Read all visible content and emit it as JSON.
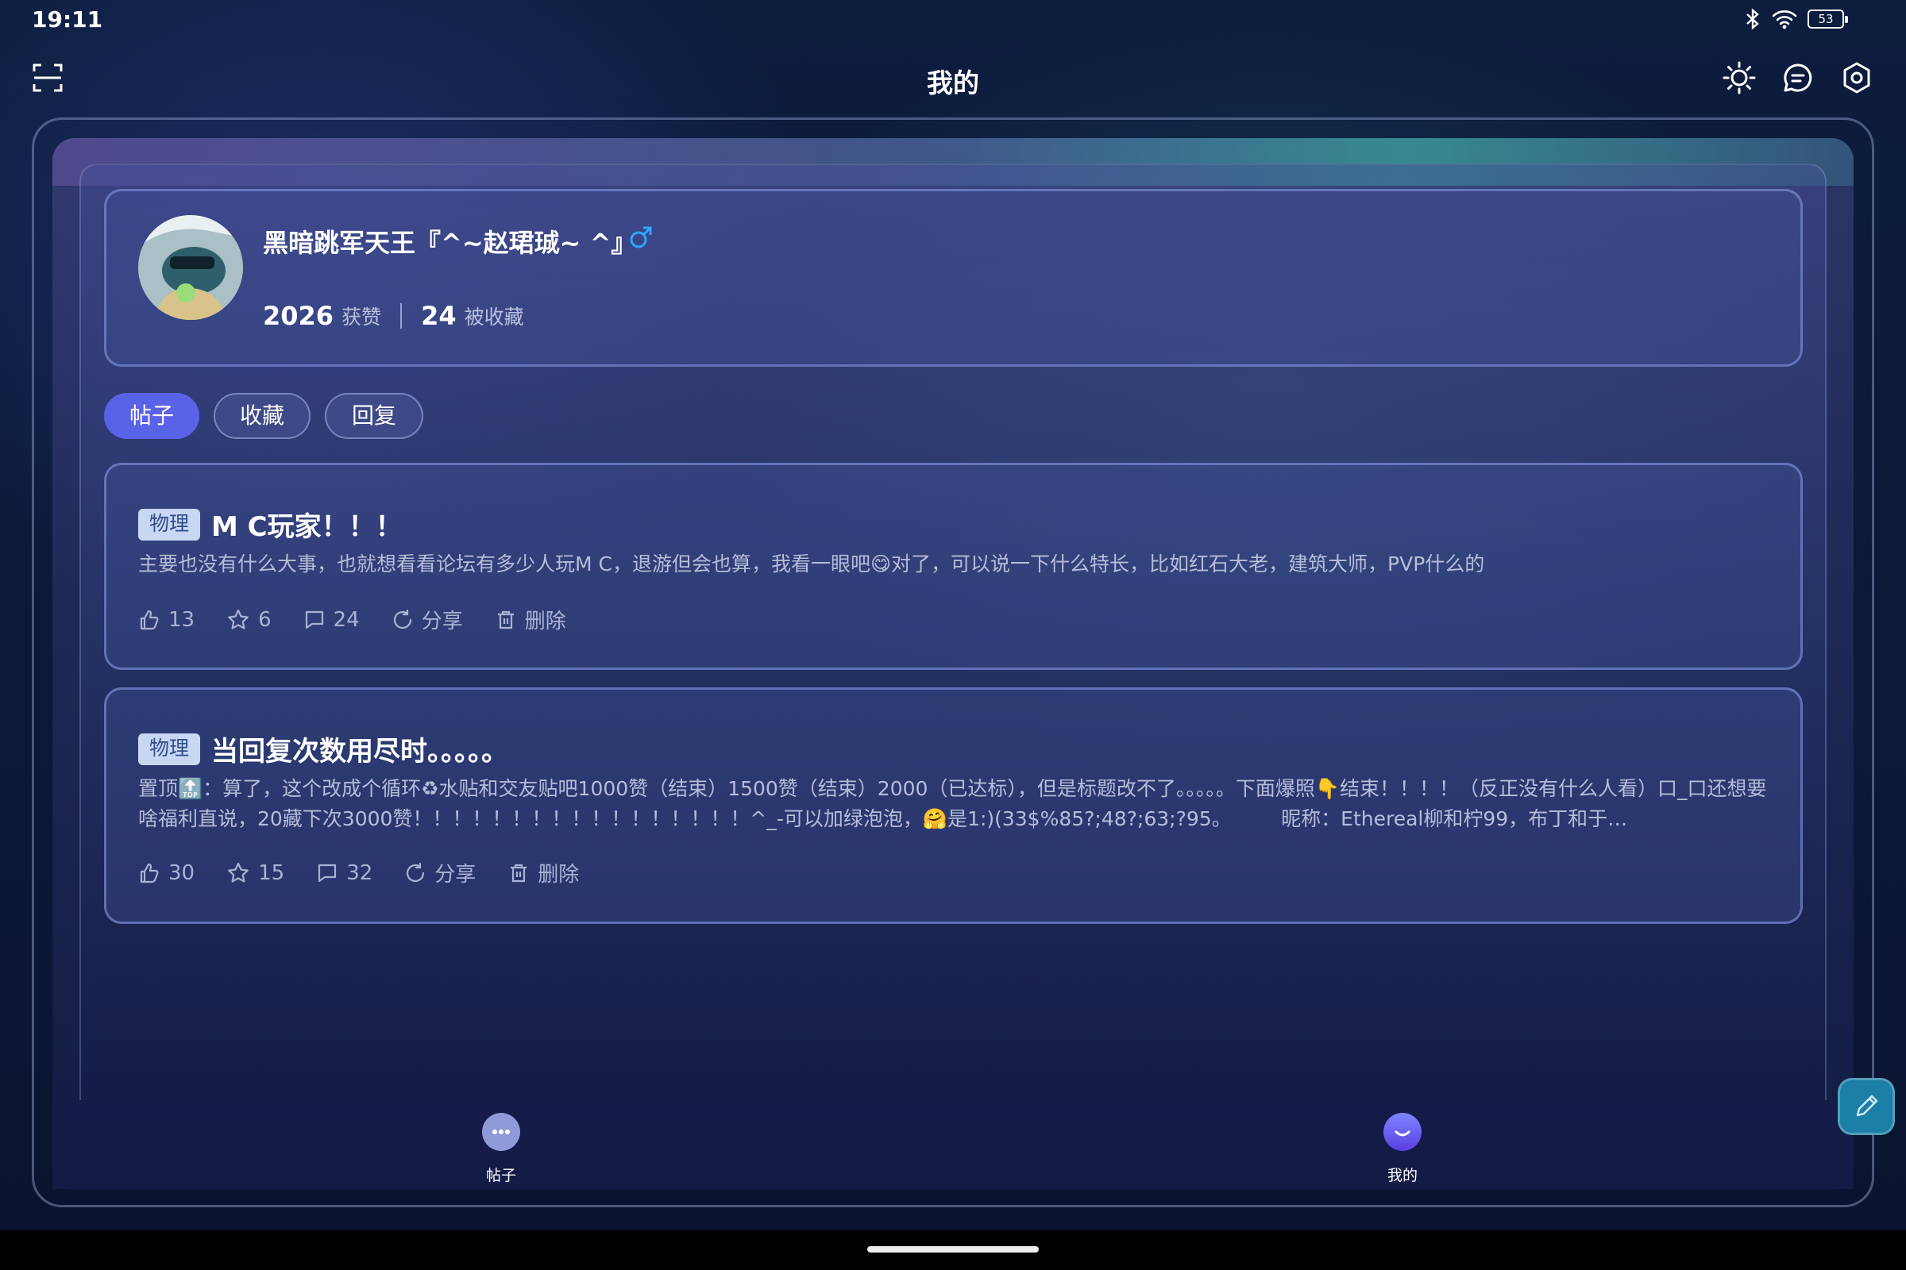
{
  "status": {
    "time": "19:11",
    "battery": "53"
  },
  "header": {
    "title": "我的"
  },
  "profile": {
    "name": "黑暗跳军天王『^~赵珺珹~ ^』",
    "likes": "2026",
    "likes_label": "获赞",
    "favs": "24",
    "favs_label": "被收藏"
  },
  "tabs": [
    {
      "label": "帖子"
    },
    {
      "label": "收藏"
    },
    {
      "label": "回复"
    }
  ],
  "posts": [
    {
      "category": "物理",
      "title": "M C玩家！！！",
      "body": "主要也没有什么大事，也就想看看论坛有多少人玩M C，退游但会也算，我看一眼吧😋对了，可以说一下什么特长，比如红石大老，建筑大师，PVP什么的",
      "likes": "13",
      "favs": "6",
      "comments": "24",
      "share": "分享",
      "delete": "删除"
    },
    {
      "category": "物理",
      "title": "当回复次数用尽时。。。。。",
      "body": "置顶🔝：算了，这个改成个循环♻水贴和交友贴吧1000赞（结束）1500赞（结束）2000（已达标），但是标题改不了。。。。。下面爆照👇结束！！！！（反正没有什么人看）口_口还想要啥福利直说，20藏下次3000赞！！！！！！！！！！！！！！！！！^_-可以加绿泡泡，🤗是1:)(33$%85?;48?;63;?95。　　　昵称：Ethereal柳和柠99，布丁和于…",
      "likes": "30",
      "favs": "15",
      "comments": "32",
      "share": "分享",
      "delete": "删除"
    }
  ],
  "nav": [
    {
      "label": "帖子"
    },
    {
      "label": "我的"
    }
  ],
  "colors": {
    "accent": "#5a62e8",
    "fab": "#1b7fa6",
    "badge_bg": "#c8d7f2"
  }
}
